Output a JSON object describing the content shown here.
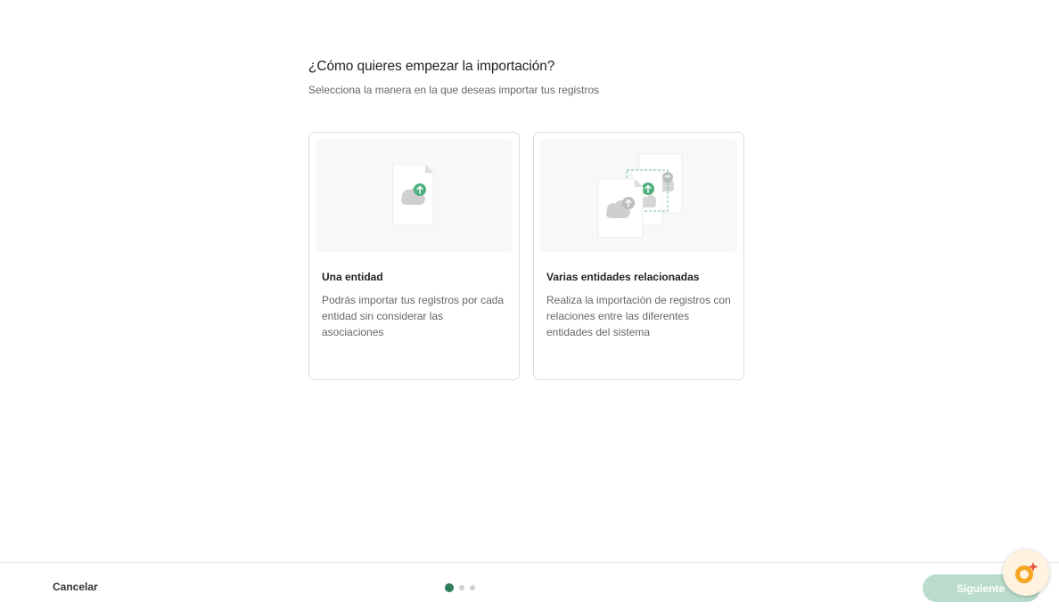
{
  "header": {
    "title": "¿Cómo quieres empezar la importación?",
    "subtitle": "Selecciona la manera en la que deseas importar tus registros"
  },
  "options": [
    {
      "title": "Una entidad",
      "description": "Podrás importar tus registros por cada entidad sin considerar las asociaciones",
      "icon": "single-file-upload-icon"
    },
    {
      "title": "Varias entidades relacionadas",
      "description": "Realiza la importación de registros con relaciones entre las diferentes entidades del sistema",
      "icon": "multi-file-upload-icon"
    }
  ],
  "footer": {
    "cancel_label": "Cancelar",
    "next_label": "Siguiente",
    "steps_total": 3,
    "current_step": 1
  },
  "colors": {
    "accent": "#2e7d5b",
    "upload_green": "#4caf7d",
    "next_disabled": "#b9dccb",
    "assistant_orange": "#f5a623"
  },
  "assistant": {
    "icon": "assistant-sparkle-icon"
  }
}
